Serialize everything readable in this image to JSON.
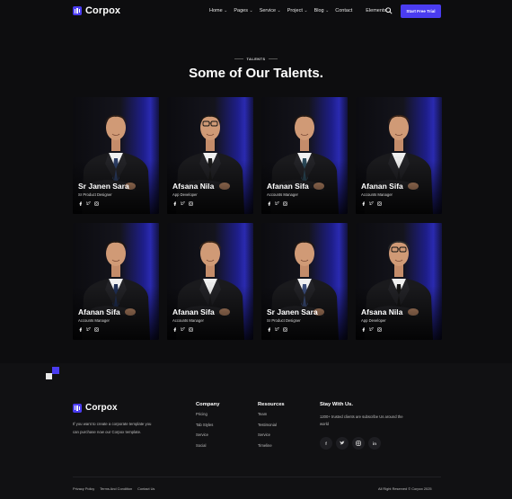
{
  "brand": {
    "name": "Corpox",
    "accent": "#4a3cf0"
  },
  "nav": {
    "items": [
      {
        "label": "Home",
        "dropdown": true
      },
      {
        "label": "Pages",
        "dropdown": true
      },
      {
        "label": "Service",
        "dropdown": true
      },
      {
        "label": "Project",
        "dropdown": true
      },
      {
        "label": "Blog",
        "dropdown": true
      },
      {
        "label": "Contact",
        "dropdown": false
      },
      {
        "label": "Elements",
        "dropdown": true
      }
    ],
    "cta_label": "Start Free Trial"
  },
  "section": {
    "tag": "TALENTS",
    "title": "Some of Our Talents."
  },
  "talents": [
    {
      "name": "Sr Janen Sara",
      "role": "Sr Product Designer"
    },
    {
      "name": "Afsana Nila",
      "role": "App Developer"
    },
    {
      "name": "Afanan Sifa",
      "role": "Accounts Manager"
    },
    {
      "name": "Afanan Sifa",
      "role": "Accounts Manager"
    },
    {
      "name": "Afanan Sifa",
      "role": "Accounts Manager"
    },
    {
      "name": "Afanan Sifa",
      "role": "Accounts Manager"
    },
    {
      "name": "Sr Janen Sara",
      "role": "Sr Product Designer"
    },
    {
      "name": "Afsana Nila",
      "role": "App Developer"
    }
  ],
  "footer": {
    "brand": "Corpox",
    "description": "If you want to create a corporate template you can purchase now our Corpox template.",
    "company": {
      "heading": "Company",
      "links": [
        "Pricing",
        "Tab Styles",
        "Service",
        "Social"
      ]
    },
    "resources": {
      "heading": "Resources",
      "links": [
        "Team",
        "Testimonial",
        "Service",
        "Timeline"
      ]
    },
    "stay": {
      "heading": "Stay With Us.",
      "text": "1200+ trusted clients are subscribe Us around the world"
    },
    "socials": [
      "facebook-icon",
      "twitter-icon",
      "instagram-icon",
      "linkedin-icon"
    ],
    "bottom_links": [
      "Privacy Policy",
      "Terms And Condition",
      "Contact Us"
    ],
    "copyright": "All Right Reserved © Corpox 2025"
  }
}
